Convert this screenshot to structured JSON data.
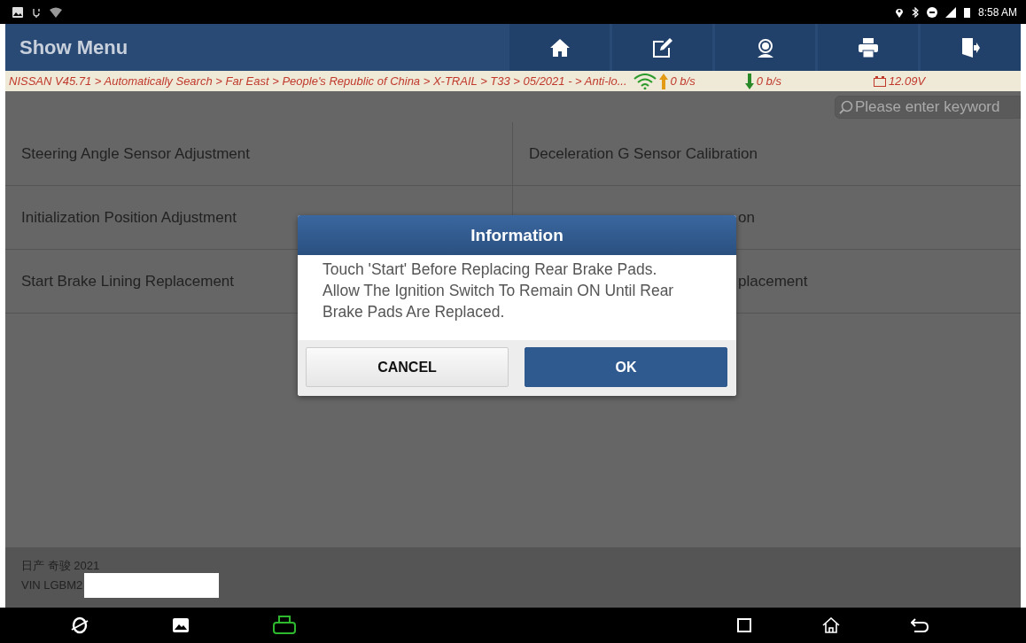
{
  "status_bar": {
    "time": "8:58 AM"
  },
  "header": {
    "title": "Show Menu"
  },
  "breadcrumb": {
    "path": "NISSAN V45.71 > Automatically Search > Far East > People's Republic of China > X-TRAIL > T33 > 05/2021 - > Anti-lo...",
    "upload": "0 b/s",
    "download": "0 b/s",
    "voltage": "12.09V"
  },
  "search": {
    "placeholder": "Please enter keyword"
  },
  "menu_items": [
    {
      "label": "Steering Angle Sensor Adjustment",
      "covered": false
    },
    {
      "label": "Deceleration G Sensor Calibration",
      "covered": false
    },
    {
      "label": "Initialization Position Adjustment",
      "covered": false
    },
    {
      "label": "on",
      "covered": true
    },
    {
      "label": "Start Brake Lining Replacement",
      "covered": false
    },
    {
      "label": "placement",
      "covered": true
    }
  ],
  "dialog": {
    "title": "Information",
    "lines": [
      "Touch 'Start' Before Replacing Rear Brake Pads.",
      "Allow The Ignition Switch To Remain ON Until Rear Brake Pads Are Replaced."
    ],
    "buttons": [
      {
        "label": "CANCEL",
        "kind": "secondary"
      },
      {
        "label": "OK",
        "kind": "primary"
      }
    ]
  },
  "footer": {
    "model": "日产 奇骏 2021",
    "vin": "VIN LGBM2"
  }
}
